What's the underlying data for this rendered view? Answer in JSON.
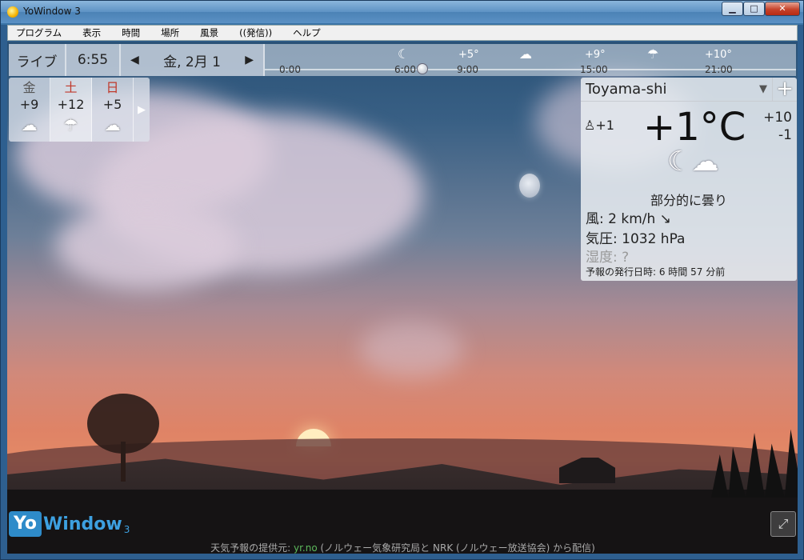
{
  "window": {
    "title": "YoWindow 3",
    "min": "▁",
    "max": "□",
    "close": "✕"
  },
  "menu": [
    "プログラム",
    "表示",
    "時間",
    "場所",
    "風景",
    "((発信))",
    "ヘルプ"
  ],
  "timebar": {
    "live": "ライブ",
    "time": "6:55",
    "date": "金, 2月 1",
    "prev_icon": "◀",
    "next_icon": "▶",
    "hours": [
      "0:00",
      "6:00",
      "9:00",
      "15:00",
      "21:00"
    ],
    "temps": [
      "+5°",
      "+9°",
      "+10°"
    ],
    "icons": [
      "moon-icon",
      "cloud-icon",
      "rain-icon"
    ]
  },
  "forecast": [
    {
      "day": "金",
      "temp": "+9",
      "icon": "cloud-icon"
    },
    {
      "day": "土",
      "temp": "+12",
      "icon": "rain-icon"
    },
    {
      "day": "日",
      "temp": "+5",
      "icon": "cloud-icon"
    }
  ],
  "current": {
    "city": "Toyama-shi",
    "feels": "+1",
    "temp": "+1°C",
    "high": "+10",
    "low": "-1",
    "condition": "部分的に曇り",
    "wind": "風:  2 km/h ↘",
    "pressure": "気圧:  1032 hPa",
    "humidity": "湿度:  ?",
    "issued": "予報の発行日時: 6 時間 57 分前"
  },
  "logo": {
    "yo": "Yo",
    "rest": "Window",
    "version": "3"
  },
  "credits": {
    "prefix": "天気予報の提供元: ",
    "link": "yr.no",
    "suffix": " (ノルウェー気象研究局と NRK (ノルウェー放送協会) から配信)"
  }
}
